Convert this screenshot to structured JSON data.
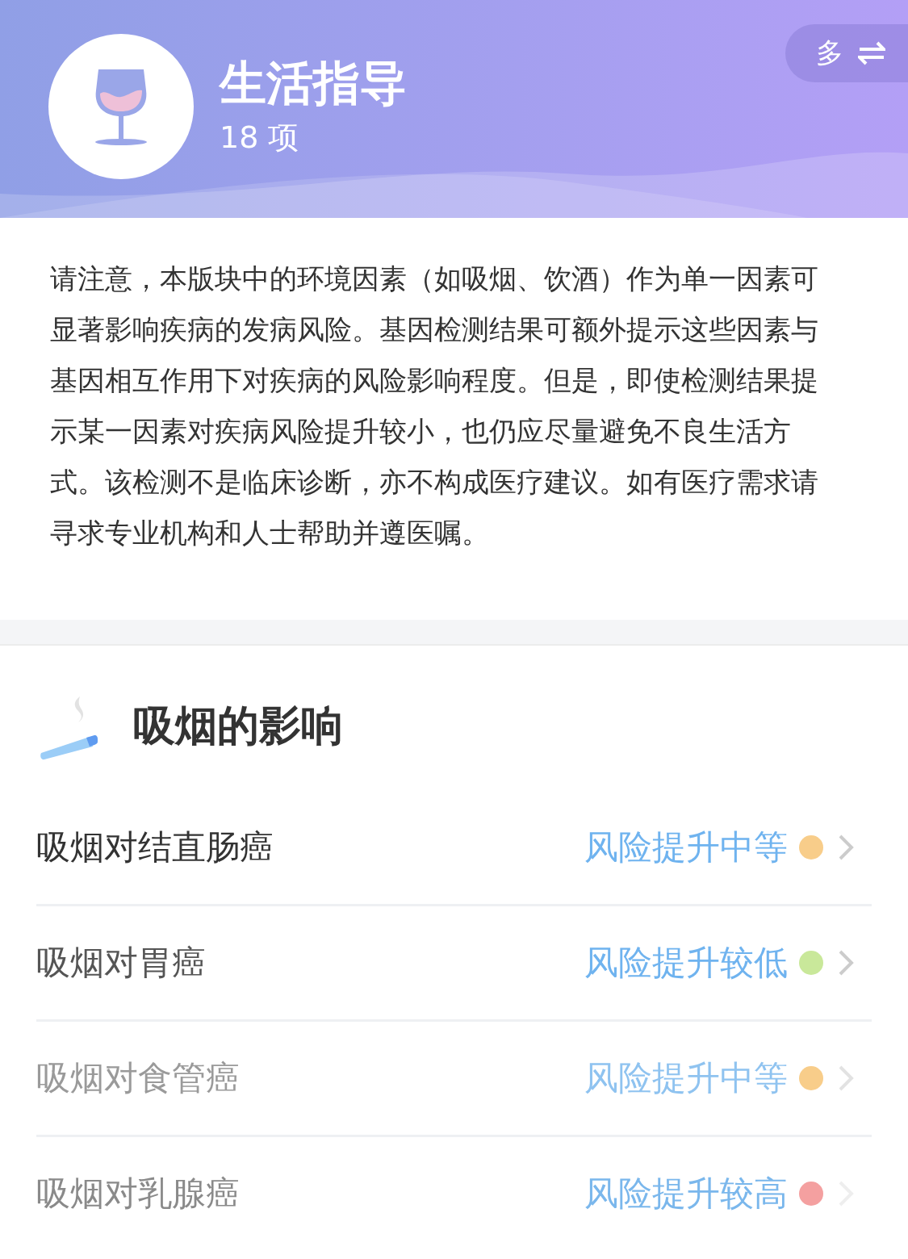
{
  "header": {
    "title": "生活指导",
    "count": "18 项",
    "toggle": {
      "label": "多"
    }
  },
  "notice": "请注意，本版块中的环境因素（如吸烟、饮酒）作为单一因素可显著影响疾病的发病风险。基因检测结果可额外提示这些因素与基因相互作用下对疾病的风险影响程度。但是，即使检测结果提示某一因素对疾病风险提升较小，也仍应尽量避免不良生活方式。该检测不是临床诊断，亦不构成医疗建议。如有医疗需求请寻求专业机构和人士帮助并遵医嘱。",
  "section": {
    "title": "吸烟的影响",
    "items": [
      {
        "name": "吸烟对结直肠癌",
        "risk": "风险提升中等",
        "color": "#f8cd8a"
      },
      {
        "name": "吸烟对胃癌",
        "risk": "风险提升较低",
        "color": "#c9e89a"
      },
      {
        "name": "吸烟对食管癌",
        "risk": "风险提升中等",
        "color": "#f8cd8a"
      },
      {
        "name": "吸烟对乳腺癌",
        "risk": "风险提升较高",
        "color": "#f4a0a0"
      }
    ]
  }
}
